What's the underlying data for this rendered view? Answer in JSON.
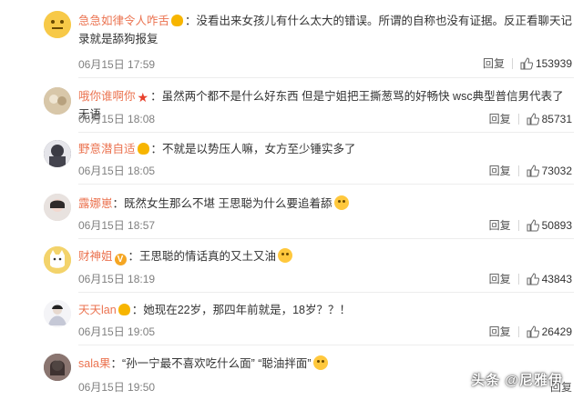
{
  "comments": [
    {
      "username": "急急如律令人咋舌",
      "badge": "crown",
      "text": "没看出来女孩儿有什么太大的错误。所谓的自称也没有证据。反正看聊天记录就是舔狗报复",
      "time": "06月15日 17:59",
      "reply": "回复",
      "likes": "153939",
      "avatar_color": "#f7c948"
    },
    {
      "username": "哦你谁啊你",
      "badge": "star",
      "text": "虽然两个都不是什么好东西 但是宁姐把王撕葱骂的好畅快 wsc典型普信男代表了 无语",
      "time": "06月15日 18:08",
      "reply": "回复",
      "likes": "85731",
      "avatar_color": "#c9b79a"
    },
    {
      "username": "野意潜自适",
      "badge": "crown",
      "text": "不就是以势压人嘛，女方至少锤实多了",
      "time": "06月15日 18:05",
      "reply": "回复",
      "likes": "73032",
      "avatar_color": "#5a5a66"
    },
    {
      "username": "露娜崽",
      "badge": "",
      "text": "既然女生那么不堪 王思聪为什么要追着舔",
      "emoji": "smile-emoji",
      "time": "06月15日 18:57",
      "reply": "回复",
      "likes": "50893",
      "avatar_color": "#d8d0cc"
    },
    {
      "username": "财神姐",
      "badge": "v",
      "text": "王思聪的情话真的又土又油",
      "emoji": "laugh-emoji",
      "time": "06月15日 18:19",
      "reply": "回复",
      "likes": "43843",
      "avatar_color": "#f3d36b"
    },
    {
      "username": "天天lan",
      "badge": "crown",
      "text": "她现在22岁，那四年前就是，18岁？？！",
      "time": "06月15日 19:05",
      "reply": "回复",
      "likes": "26429",
      "avatar_color": "#e9e9ee"
    },
    {
      "username": "sala果",
      "badge": "",
      "text": "“孙一宁最不喜欢吃什么面” “聪油拌面”",
      "emoji": "cute-emoji",
      "time": "06月15日 19:50",
      "reply": "回复",
      "likes": "",
      "avatar_color": "#6d5a55"
    }
  ],
  "watermark": "头条 @尼雅伊",
  "colors": {
    "username": "#eb7350",
    "meta": "#808080",
    "divider": "#ededed"
  }
}
